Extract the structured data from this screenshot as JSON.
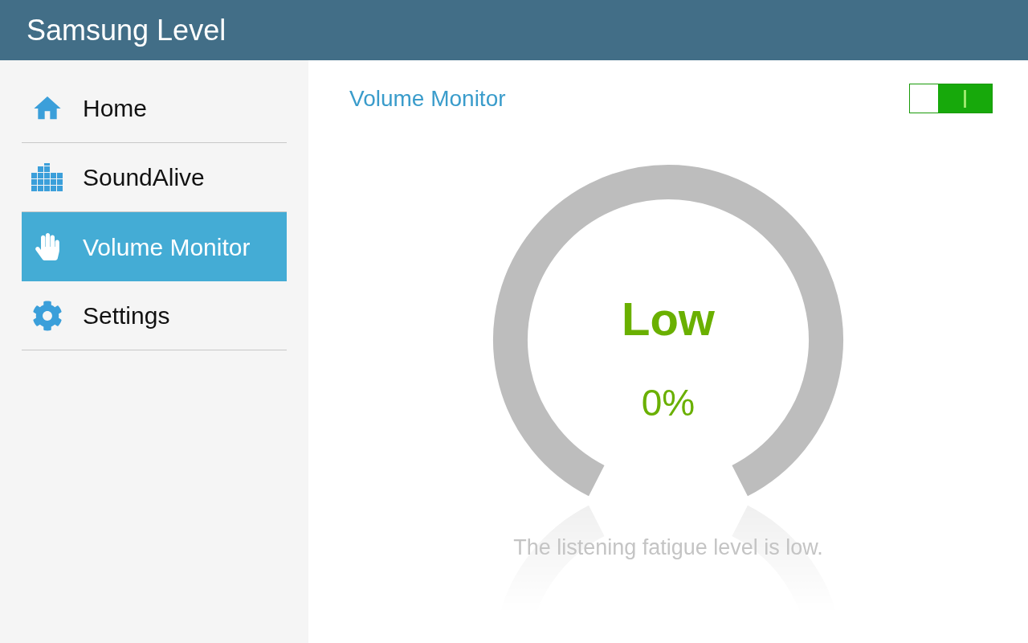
{
  "app_bar": {
    "title": "Samsung Level"
  },
  "sidebar": {
    "items": [
      {
        "label": "Home",
        "selected": false
      },
      {
        "label": "SoundAlive",
        "selected": false
      },
      {
        "label": "Volume Monitor",
        "selected": true
      },
      {
        "label": "Settings",
        "selected": false
      }
    ]
  },
  "main": {
    "title": "Volume Monitor",
    "switch": {
      "on": true
    },
    "gauge": {
      "status": "Low",
      "percent": "0%"
    },
    "message": "The listening fatigue level is low."
  }
}
